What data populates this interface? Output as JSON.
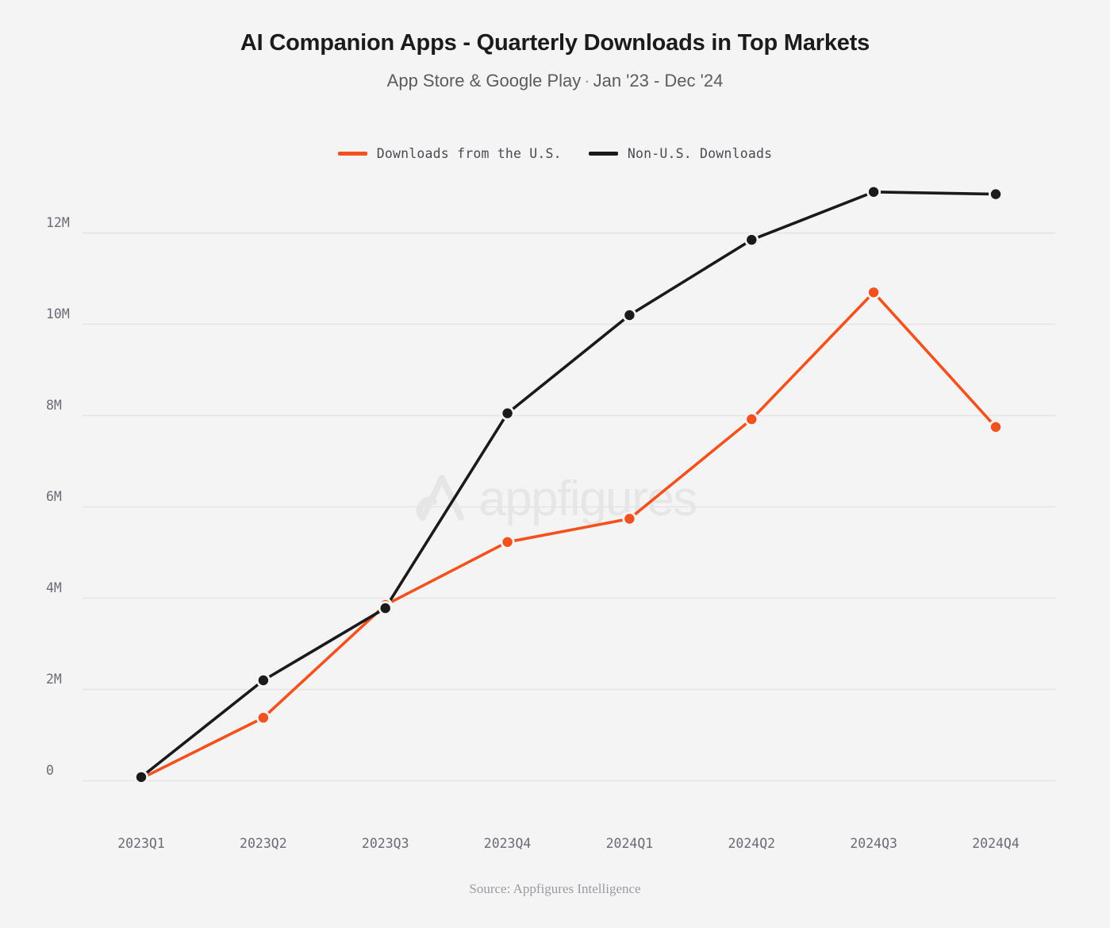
{
  "header": {
    "title": "AI Companion Apps - Quarterly Downloads in Top Markets",
    "subtitle_left": "App Store & Google Play",
    "subtitle_separator": "·",
    "subtitle_right": "Jan '23 - Dec '24"
  },
  "legend": {
    "position": "top-center",
    "items": [
      {
        "label": "Downloads from the U.S.",
        "color": "#f4511e"
      },
      {
        "label": "Non-U.S. Downloads",
        "color": "#1a1a1a"
      }
    ]
  },
  "watermark": {
    "text": "appfigures",
    "logo": "appfigures-logo-icon",
    "color": "#e6e6e6"
  },
  "footer": {
    "source": "Source: Appfigures Intelligence"
  },
  "axes": {
    "y_ticks": [
      "0",
      "2M",
      "4M",
      "6M",
      "8M",
      "10M",
      "12M"
    ],
    "x_ticks": [
      "2023Q1",
      "2023Q2",
      "2023Q3",
      "2023Q4",
      "2024Q1",
      "2024Q2",
      "2024Q3",
      "2024Q4"
    ]
  },
  "chart_data": {
    "type": "line",
    "title": "AI Companion Apps - Quarterly Downloads in Top Markets",
    "subtitle": "App Store & Google Play · Jan '23 - Dec '24",
    "xlabel": "",
    "ylabel": "",
    "categories": [
      "2023Q1",
      "2023Q2",
      "2023Q3",
      "2023Q4",
      "2024Q1",
      "2024Q2",
      "2024Q3",
      "2024Q4"
    ],
    "ylim": [
      0,
      13500000
    ],
    "y_tick_values": [
      0,
      2000000,
      4000000,
      6000000,
      8000000,
      10000000,
      12000000
    ],
    "y_tick_labels": [
      "0",
      "2M",
      "4M",
      "6M",
      "8M",
      "10M",
      "12M"
    ],
    "grid": "horizontal-only",
    "legend_position": "top-center",
    "markers": true,
    "series": [
      {
        "name": "Downloads from the U.S.",
        "color": "#f4511e",
        "values": [
          50000,
          1380000,
          3850000,
          5230000,
          5740000,
          7920000,
          10700000,
          7750000
        ]
      },
      {
        "name": "Non-U.S. Downloads",
        "color": "#1a1a1a",
        "values": [
          80000,
          2200000,
          3780000,
          8050000,
          10200000,
          11850000,
          12900000,
          12850000
        ]
      }
    ]
  }
}
